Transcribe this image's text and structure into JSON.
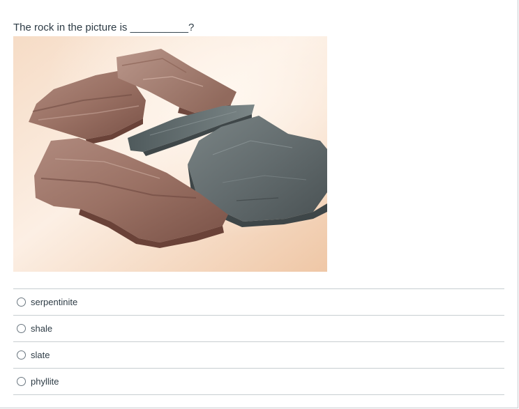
{
  "question": {
    "text": "The rock in the picture is __________?"
  },
  "image": {
    "subject": "slate-rock-photo",
    "colors": {
      "background_light": "#fbeee3",
      "background_warm": "#efc9a8",
      "rock_brown": "#8a5f55",
      "rock_gray": "#5b6466"
    }
  },
  "answers": [
    {
      "label": "serpentinite"
    },
    {
      "label": "shale"
    },
    {
      "label": "slate"
    },
    {
      "label": "phyllite"
    }
  ],
  "colors": {
    "text": "#2d3b45",
    "divider": "#c7cdd1",
    "radio_border": "#6b7780"
  }
}
